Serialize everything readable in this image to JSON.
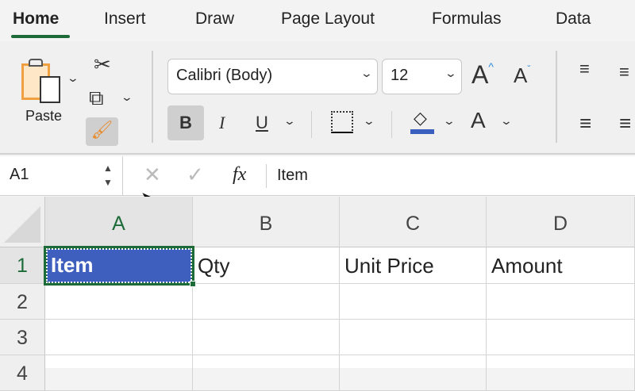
{
  "tabs": [
    {
      "label": "Home",
      "active": true
    },
    {
      "label": "Insert"
    },
    {
      "label": "Draw"
    },
    {
      "label": "Page Layout"
    },
    {
      "label": "Formulas"
    },
    {
      "label": "Data"
    }
  ],
  "ribbon": {
    "paste_label": "Paste",
    "font_name": "Calibri (Body)",
    "font_size": "12",
    "bold": "B",
    "italic": "I",
    "underline": "U",
    "font_color_glyph": "A",
    "grow_glyph": "A",
    "shrink_glyph": "A",
    "fill_color": "#3a5fbf"
  },
  "formula_bar": {
    "name_box": "A1",
    "fx": "fx",
    "value": "Item"
  },
  "sheet": {
    "columns": [
      "A",
      "B",
      "C",
      "D"
    ],
    "rows": [
      "1",
      "2",
      "3",
      "4"
    ],
    "cells": {
      "A1": "Item",
      "B1": "Qty",
      "C1": "Unit Price",
      "D1": "Amount"
    },
    "selected": "A1",
    "colors": {
      "selection_fill": "#3f5fbf",
      "selection_border": "#1e6b3a"
    }
  }
}
